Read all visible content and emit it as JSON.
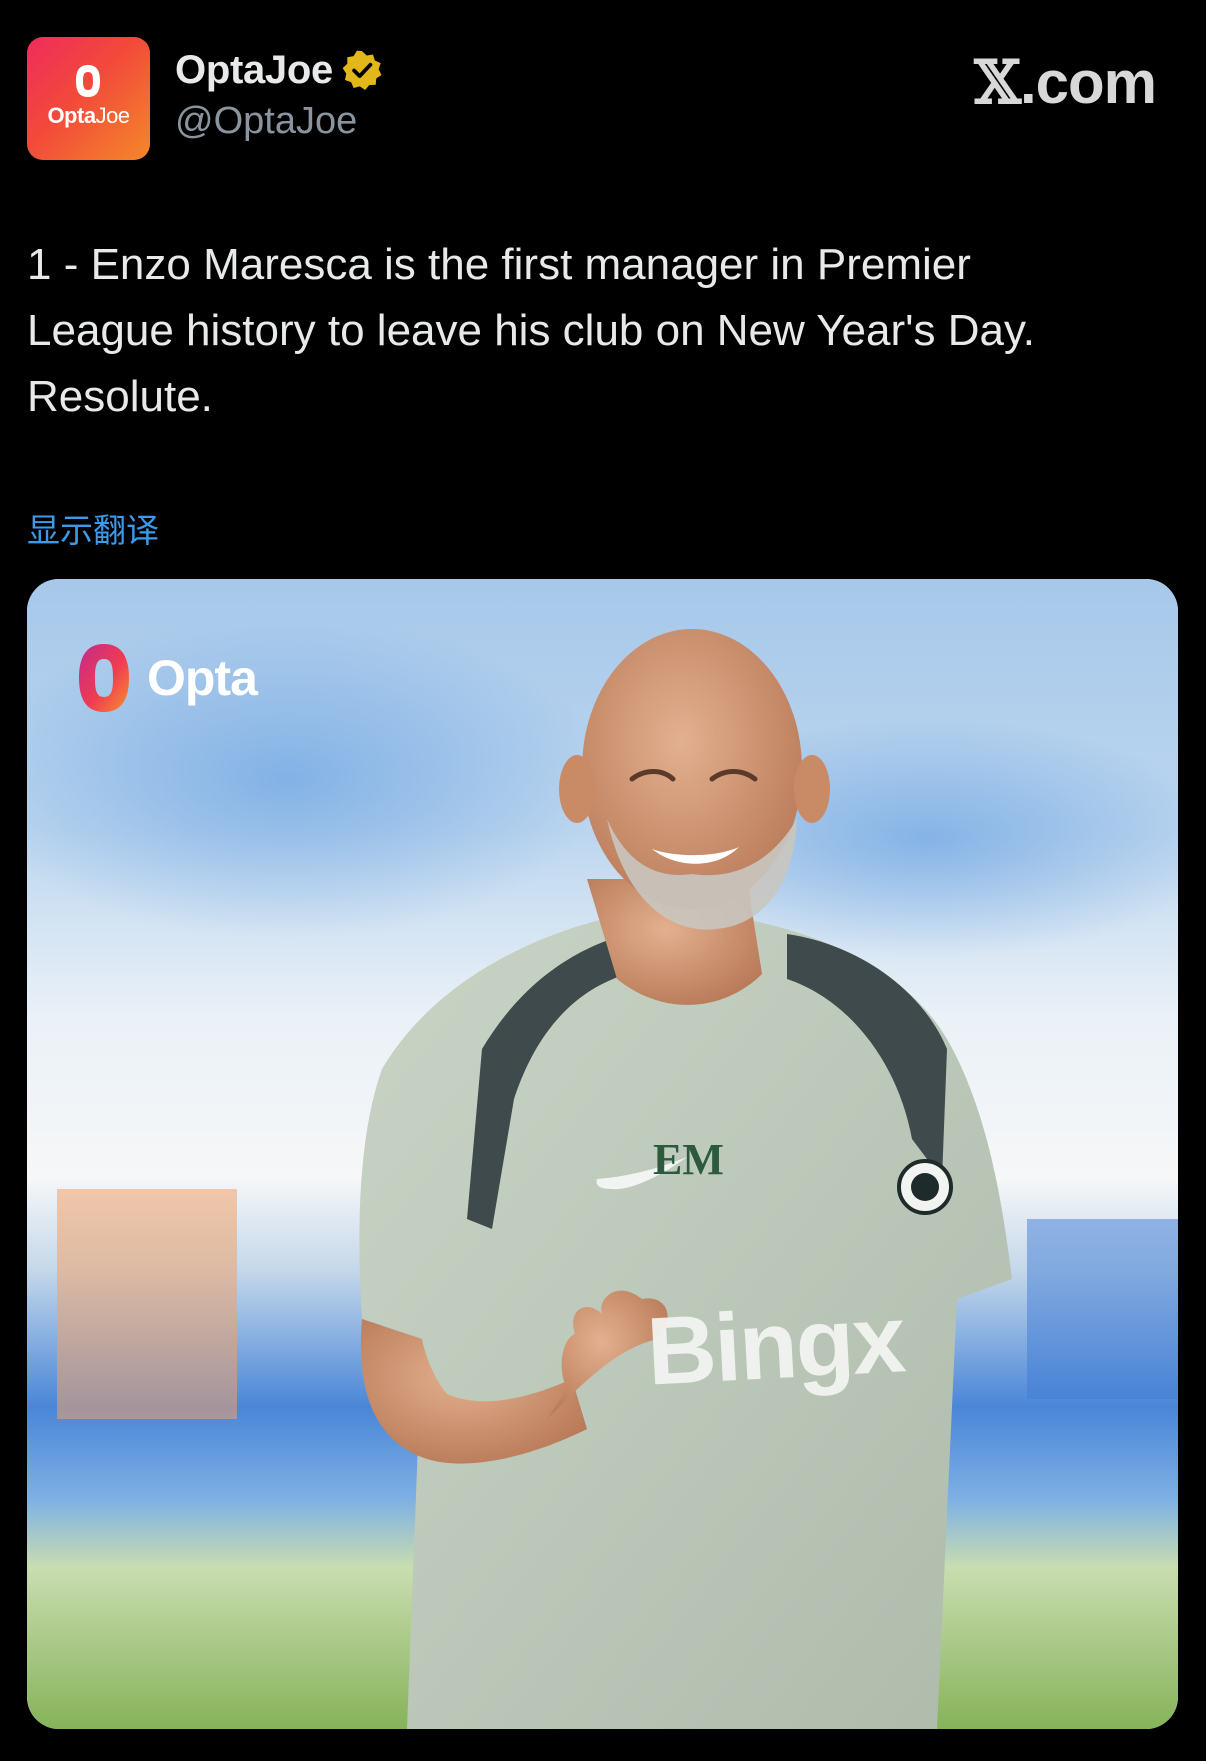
{
  "header": {
    "display_name": "OptaJoe",
    "handle": "@OptaJoe",
    "verified_icon": "verified-badge-icon",
    "avatar": {
      "icon": "opta-joe-logo",
      "text_bold": "Opta",
      "text_light": "Joe"
    },
    "brand_x": "𝕏",
    "brand_suffix": ".com"
  },
  "tweet": {
    "lines": [
      "1 - Enzo Maresca is the first manager in Premier",
      "League history to leave his club on New Year's Day.",
      "Resolute."
    ],
    "translate_label": "显示翻译"
  },
  "media": {
    "logo_text": "Opta",
    "shirt_initials": "EM",
    "shirt_sponsor": "Bingx"
  },
  "colors": {
    "background": "#000000",
    "text_primary": "#e7e9ea",
    "text_secondary": "#8b949e",
    "link": "#3b9aea",
    "verified": "#e2b719",
    "avatar_gradient_start": "#ef2b5c",
    "avatar_gradient_end": "#f5882a"
  }
}
